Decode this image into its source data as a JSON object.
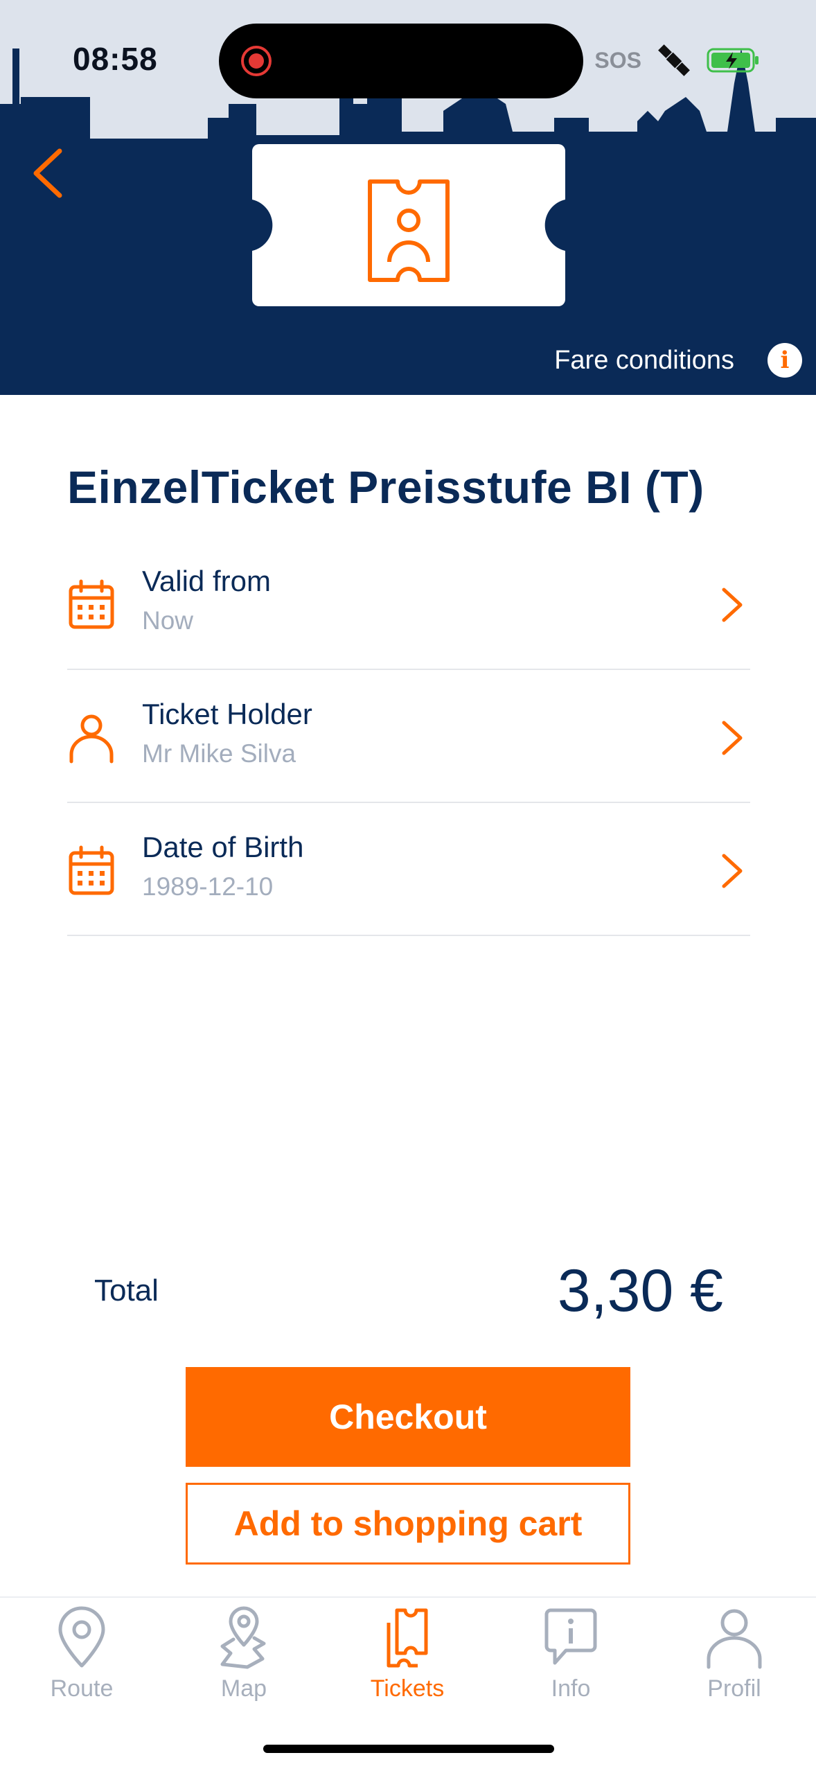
{
  "status_bar": {
    "time": "08:58",
    "sos": "SOS"
  },
  "header": {
    "fare_conditions": "Fare conditions",
    "info_glyph": "i"
  },
  "ticket": {
    "title": "EinzelTicket Preisstufe BI (T)",
    "rows": [
      {
        "label": "Valid from",
        "value": "Now",
        "icon": "calendar-icon"
      },
      {
        "label": "Ticket Holder",
        "value": "Mr Mike Silva",
        "icon": "person-icon"
      },
      {
        "label": "Date of Birth",
        "value": "1989-12-10",
        "icon": "calendar-icon"
      }
    ]
  },
  "summary": {
    "total_label": "Total",
    "total_value": "3,30 €"
  },
  "actions": {
    "checkout": "Checkout",
    "add_to_cart": "Add to shopping cart"
  },
  "tabs": [
    {
      "label": "Route",
      "icon": "location-pin-icon",
      "active": false
    },
    {
      "label": "Map",
      "icon": "map-icon",
      "active": false
    },
    {
      "label": "Tickets",
      "icon": "tickets-icon",
      "active": true
    },
    {
      "label": "Info",
      "icon": "info-bubble-icon",
      "active": false
    },
    {
      "label": "Profil",
      "icon": "profile-icon",
      "active": false
    }
  ],
  "colors": {
    "navy": "#0a2a57",
    "accent": "#ff6a00",
    "muted": "#a3adbd"
  }
}
